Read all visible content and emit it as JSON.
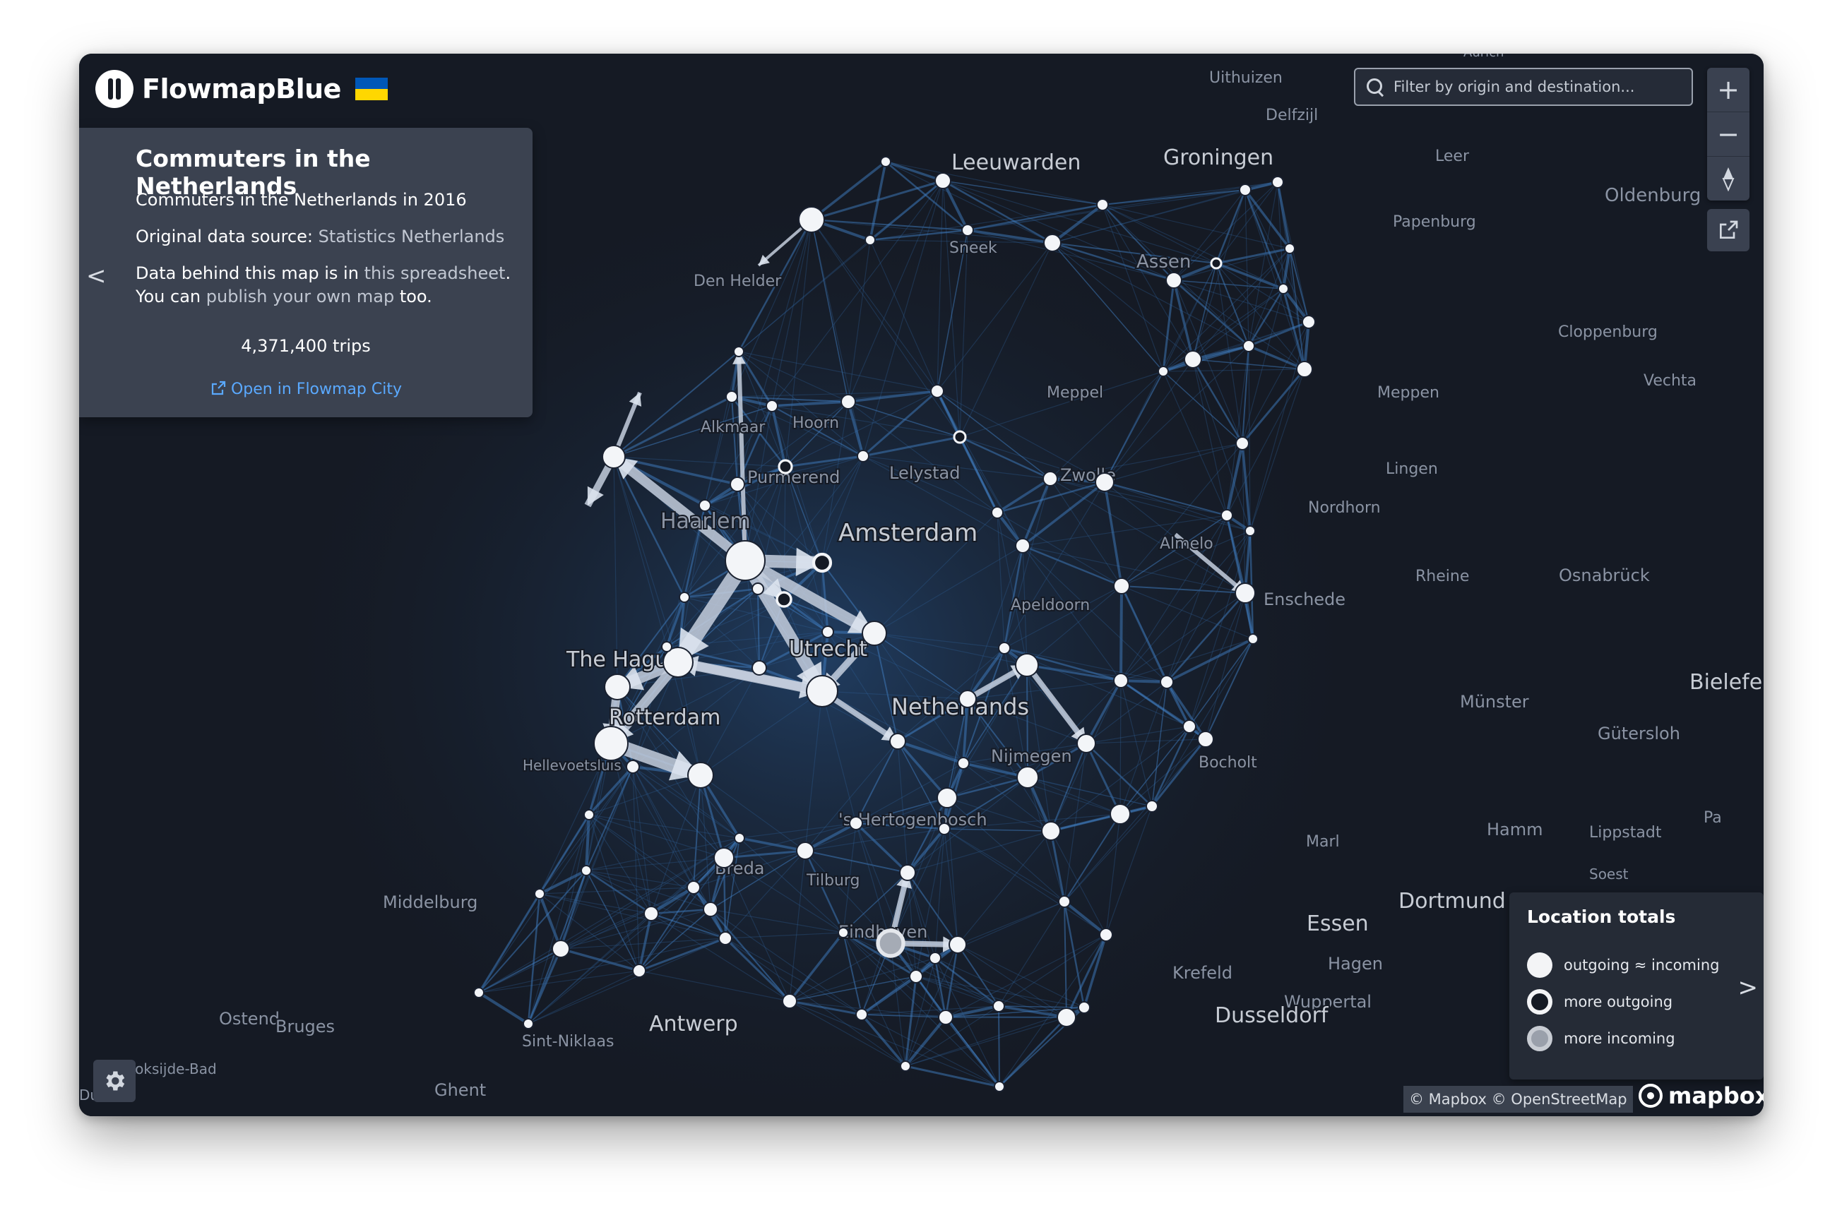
{
  "app": {
    "name": "FlowmapBlue",
    "flag": "Ukraine"
  },
  "panel": {
    "title": "Commuters in the Netherlands",
    "subtitle": "Commuters in the Netherlands in 2016",
    "source_prefix": "Original data source: ",
    "source_link": "Statistics Netherlands",
    "data_prefix": "Data behind this map is in ",
    "data_link": "this spreadsheet",
    "data_suffix": ".",
    "publish_prefix": "You can ",
    "publish_link": "publish your own map",
    "publish_suffix": " too.",
    "trips": "4,371,400 trips",
    "open_link": "Open in Flowmap City",
    "collapse_icon": "chevron-left-icon",
    "collapse_label": "<"
  },
  "search": {
    "placeholder": "Filter by origin and destination..."
  },
  "controls": {
    "zoom_in": "+",
    "zoom_out": "−",
    "compass": "compass-icon",
    "external": "external-link-icon"
  },
  "legend": {
    "title": "Location totals",
    "items": [
      {
        "label": "outgoing ≈ incoming",
        "style": "filled"
      },
      {
        "label": "more outgoing",
        "style": "ring"
      },
      {
        "label": "more incoming",
        "style": "pale"
      }
    ],
    "expand_label": ">"
  },
  "attribution": "© Mapbox © OpenStreetMap",
  "mapbox_logo": "mapbox",
  "settings_icon": "gear-icon",
  "map_labels": {
    "big": [
      "Amsterdam",
      "Leeuwarden",
      "Groningen",
      "The Hague",
      "Rotterdam",
      "Utrecht",
      "Netherlands",
      "Antwerp",
      "Essen",
      "Dortmund",
      "Dusseldorf",
      "Bielefeld"
    ],
    "small": [
      "Uithuizen",
      "Delfzijl",
      "Leer",
      "Oldenburg",
      "Papenburg",
      "Sneek",
      "Assen",
      "Den Helder",
      "Cloppenburg",
      "Meppel",
      "Meppen",
      "Vechta",
      "Alkmaar",
      "Hoorn",
      "Lelystad",
      "Zwolle",
      "Lingen",
      "Purmerend",
      "Haarlem",
      "Nordhorn",
      "Almelo",
      "Rheine",
      "Osnabrück",
      "Apeldoorn",
      "Enschede",
      "Münster",
      "Gütersloh",
      "Nijmegen",
      "Hellevoetsluis",
      "Bocholt",
      "'s-Hertogenbosch",
      "Marl",
      "Hamm",
      "Lippstadt",
      "Breda",
      "Tilburg",
      "Soest",
      "Middelburg",
      "Eindhoven",
      "Krefeld",
      "Hagen",
      "Wuppertal",
      "Ostend",
      "Bruges",
      "Sint-Niklaas",
      "Koksijde-Bad",
      "Dunkirk",
      "Ghent",
      "Aurich",
      "Pa"
    ]
  }
}
